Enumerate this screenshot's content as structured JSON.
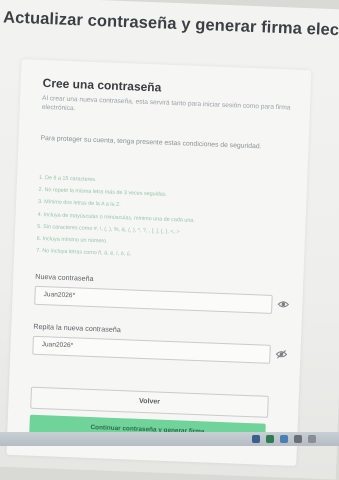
{
  "page": {
    "title": "Actualizar contraseña y generar firma electró"
  },
  "form": {
    "heading": "Cree una contraseña",
    "intro": "Al crear una nueva contraseña, esta servirá tanto para iniciar sesión como para firma electrónica.",
    "note": "Para proteger su cuenta, tenga presente estas condiciones de seguridad.",
    "rules": [
      "1. De 8 a 15 caracteres.",
      "2. No repetir la misma letra más de 3 veces seguidas.",
      "3. Mínimo dos letras de la A a la Z.",
      "4. Incluya de mayúsculas o minúsculas, mínimo una de cada una.",
      "5. Sin caracteres como #, !, (, ), %, &, (, ), *, ?, , [, ], {, }, <, >",
      "6. Incluya mínimo un número.",
      "7. No incluya letras como ñ, á, é, í, ó, ú."
    ],
    "new_password_label": "Nueva contraseña",
    "new_password_value": "Juan2026*",
    "repeat_password_label": "Repita la nueva contraseña",
    "repeat_password_value": "Juan2026*",
    "back_button": "Volver",
    "submit_button": "Continuar contraseña y generar firma"
  },
  "colors": {
    "accent": "#6fd39a",
    "rule_text": "#94c7ad"
  },
  "icons": {
    "password_toggle": "eye-icon",
    "password_toggle_hidden": "eye-slash-icon"
  }
}
